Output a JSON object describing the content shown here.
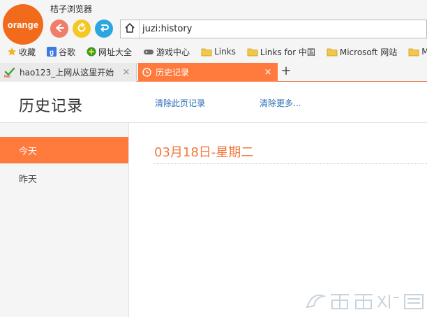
{
  "browser": {
    "logo_text": "orange",
    "app_title": "桔子浏览器",
    "address": "juzi:history"
  },
  "bookmarks": [
    {
      "label": "收藏",
      "icon": "star-icon"
    },
    {
      "label": "谷歌",
      "icon": "google-icon"
    },
    {
      "label": "网址大全",
      "icon": "green-plus-icon"
    },
    {
      "label": "游戏中心",
      "icon": "gamepad-icon"
    },
    {
      "label": "Links",
      "icon": "folder-icon"
    },
    {
      "label": "Links for 中国",
      "icon": "folder-icon"
    },
    {
      "label": "Microsoft 网站",
      "icon": "folder-icon"
    },
    {
      "label": "MS",
      "icon": "folder-icon"
    }
  ],
  "tabs": [
    {
      "title": "hao123_上网从这里开始",
      "close": "×"
    },
    {
      "title": "历史记录",
      "close": "×"
    }
  ],
  "new_tab_label": "+",
  "page": {
    "title": "历史记录",
    "clear_page_link": "清除此页记录",
    "clear_more_link": "清除更多..."
  },
  "sidebar": {
    "items": [
      {
        "label": "今天"
      },
      {
        "label": "昨天"
      }
    ]
  },
  "content": {
    "date_heading": "03月18日-星期二"
  },
  "colors": {
    "accent": "#ff7a3d",
    "logo": "#f26b1d",
    "link": "#2a6fb6",
    "back_button": "#ef7d6a",
    "refresh_button": "#f6c624",
    "restore_button": "#2aa7e0"
  }
}
